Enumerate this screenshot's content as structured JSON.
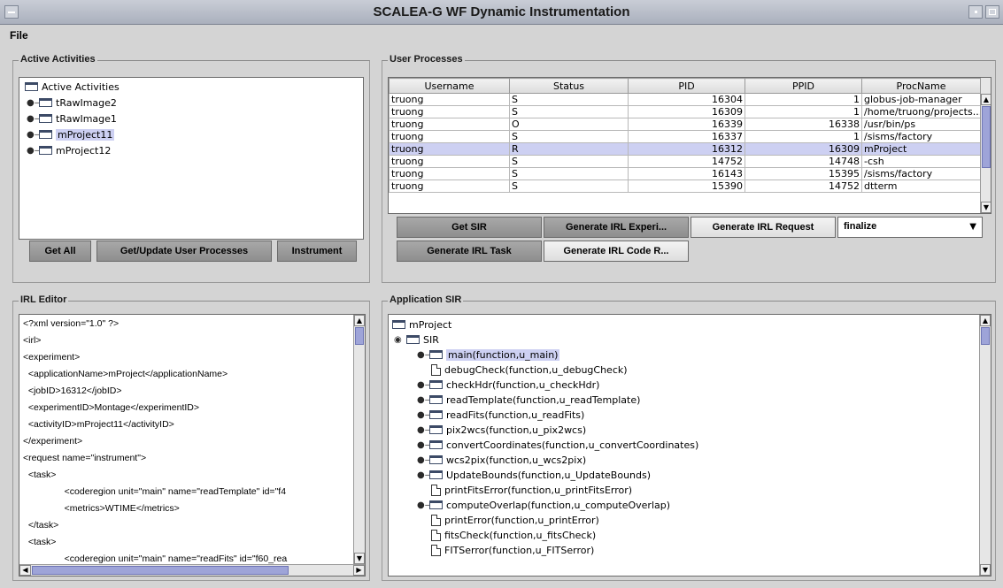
{
  "window": {
    "title": "SCALEA-G WF Dynamic Instrumentation"
  },
  "menu": {
    "file": "File"
  },
  "active_activities": {
    "group_title": "Active Activities",
    "tree": {
      "root": "Active Activities",
      "items": [
        {
          "label": "tRawImage2",
          "selected": false
        },
        {
          "label": "tRawImage1",
          "selected": false
        },
        {
          "label": "mProject11",
          "selected": true
        },
        {
          "label": "mProject12",
          "selected": false
        }
      ]
    },
    "buttons": {
      "get_all": "Get All",
      "get_update": "Get/Update User Processes",
      "instrument": "Instrument"
    }
  },
  "user_processes": {
    "group_title": "User Processes",
    "columns": [
      "Username",
      "Status",
      "PID",
      "PPID",
      "ProcName"
    ],
    "rows": [
      [
        "truong",
        "S",
        "16304",
        "1",
        "globus-job-manager"
      ],
      [
        "truong",
        "S",
        "16309",
        "1",
        "/home/truong/projects..."
      ],
      [
        "truong",
        "O",
        "16339",
        "16338",
        "/usr/bin/ps"
      ],
      [
        "truong",
        "S",
        "16337",
        "1",
        "/sisms/factory"
      ],
      [
        "truong",
        "R",
        "16312",
        "16309",
        "mProject"
      ],
      [
        "truong",
        "S",
        "14752",
        "14748",
        "-csh"
      ],
      [
        "truong",
        "S",
        "16143",
        "15395",
        "/sisms/factory"
      ],
      [
        "truong",
        "S",
        "15390",
        "14752",
        "dtterm"
      ]
    ],
    "selected_row": 4,
    "buttons": {
      "get_sir": "Get SIR",
      "gen_irl_experi": "Generate IRL Experi...",
      "gen_irl_request": "Generate IRL Request",
      "gen_irl_task": "Generate IRL Task",
      "gen_irl_code": "Generate IRL Code R..."
    },
    "request_type": "finalize"
  },
  "irl_editor": {
    "group_title": "IRL Editor",
    "lines": [
      "<?xml version=\"1.0\" ?>",
      "<irl>",
      "<experiment>",
      "  <applicationName>mProject</applicationName>",
      "  <jobID>16312</jobID>",
      "  <experimentID>Montage</experimentID>",
      "  <activityID>mProject11</activityID>",
      "</experiment>",
      "<request name=\"instrument\">",
      "  <task>",
      "                <coderegion unit=\"main\" name=\"readTemplate\" id=\"f4",
      "                <metrics>WTIME</metrics>",
      "  </task>",
      "  <task>",
      "                <coderegion unit=\"main\" name=\"readFits\" id=\"f60_rea"
    ]
  },
  "application_sir": {
    "group_title": "Application SIR",
    "root": "mProject",
    "sir": "SIR",
    "items": [
      {
        "label": "main(function,u_main)",
        "type": "folder",
        "selected": true
      },
      {
        "label": "debugCheck(function,u_debugCheck)",
        "type": "doc",
        "selected": false
      },
      {
        "label": "checkHdr(function,u_checkHdr)",
        "type": "folder",
        "selected": false
      },
      {
        "label": "readTemplate(function,u_readTemplate)",
        "type": "folder",
        "selected": false
      },
      {
        "label": "readFits(function,u_readFits)",
        "type": "folder",
        "selected": false
      },
      {
        "label": "pix2wcs(function,u_pix2wcs)",
        "type": "folder",
        "selected": false
      },
      {
        "label": "convertCoordinates(function,u_convertCoordinates)",
        "type": "folder",
        "selected": false
      },
      {
        "label": "wcs2pix(function,u_wcs2pix)",
        "type": "folder",
        "selected": false
      },
      {
        "label": "UpdateBounds(function,u_UpdateBounds)",
        "type": "folder",
        "selected": false
      },
      {
        "label": "printFitsError(function,u_printFitsError)",
        "type": "doc",
        "selected": false
      },
      {
        "label": "computeOverlap(function,u_computeOverlap)",
        "type": "folder",
        "selected": false
      },
      {
        "label": "printError(function,u_printError)",
        "type": "doc",
        "selected": false
      },
      {
        "label": "fitsCheck(function,u_fitsCheck)",
        "type": "doc",
        "selected": false
      },
      {
        "label": "FITSerror(function,u_FITSerror)",
        "type": "doc",
        "selected": false
      }
    ]
  }
}
